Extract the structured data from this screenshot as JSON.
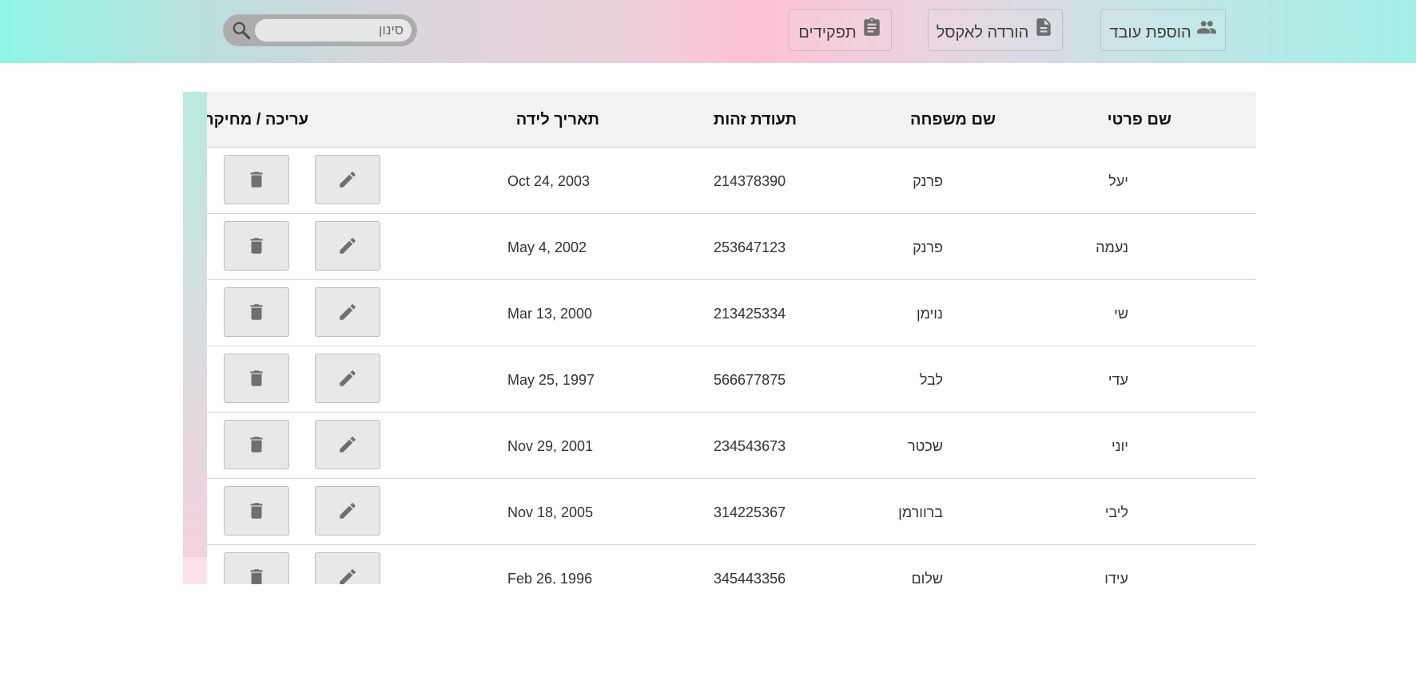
{
  "toolbar": {
    "add_employee_label": "הוספת עובד",
    "export_excel_label": "הורדה לאקסל",
    "roles_label": "תפקידים",
    "filter_placeholder": "סינון"
  },
  "table": {
    "headers": {
      "first_name": "שם פרטי",
      "last_name": "שם משפחה",
      "id_number": "תעודת זהות",
      "birth_date": "תאריך לידה",
      "actions": "עריכה / מחיקה"
    },
    "rows": [
      {
        "first_name": "יעל",
        "last_name": "פרנק",
        "id_number": "214378390",
        "birth_date": "Oct 24, 2003"
      },
      {
        "first_name": "נעמה",
        "last_name": "פרנק",
        "id_number": "253647123",
        "birth_date": "May 4, 2002"
      },
      {
        "first_name": "שי",
        "last_name": "נוימן",
        "id_number": "213425334",
        "birth_date": "Mar 13, 2000"
      },
      {
        "first_name": "עדי",
        "last_name": "לבל",
        "id_number": "566677875",
        "birth_date": "May 25, 1997"
      },
      {
        "first_name": "יוני",
        "last_name": "שכטר",
        "id_number": "234543673",
        "birth_date": "Nov 29, 2001"
      },
      {
        "first_name": "ליבי",
        "last_name": "ברוורמן",
        "id_number": "314225367",
        "birth_date": "Nov 18, 2005"
      },
      {
        "first_name": "עידו",
        "last_name": "שלום",
        "id_number": "345443356",
        "birth_date": "Feb 26, 1996"
      }
    ]
  },
  "icons": {
    "add_employee": "people-icon",
    "export_excel": "document-icon",
    "roles": "clipboard-icon",
    "search": "search-icon",
    "edit": "pencil-icon",
    "delete": "trash-icon"
  },
  "colors": {
    "gradient_mint": "#8ff5e3",
    "gradient_pink": "#fdc2d5",
    "icon_gray": "#6f6f6f",
    "header_bg": "#f2f2f2",
    "button_bg": "#e8e8e8"
  }
}
